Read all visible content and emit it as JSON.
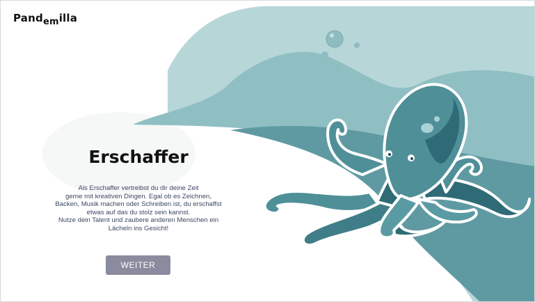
{
  "header": {
    "logo_part1": "Pand",
    "logo_part2": "em",
    "logo_part3": "illa"
  },
  "main": {
    "title": "Erschaffer",
    "description_lines": [
      "Als Erschaffer vertreibst du dir deine Zeit",
      "gerne mit kreativen Dingen. Egal ob es Zeichnen,",
      "Backen, Musik machen oder Schreiben ist, du erschaffst",
      "etwas auf das du stolz sein kannst.",
      "Nutze dein Talent und zaubere anderen Menschen ein",
      "Lächeln ins Gesicht!"
    ],
    "button_label": "WEITER"
  },
  "illustration": {
    "subject": "octopus-illustration",
    "colors": {
      "water_light": "#b7d6d8",
      "water_mid": "#8fbfc3",
      "water_dark": "#5f9aa2",
      "octopus": "#4f8f98",
      "octopus_dark": "#2e6b76",
      "button": "#8a8b9e"
    }
  }
}
